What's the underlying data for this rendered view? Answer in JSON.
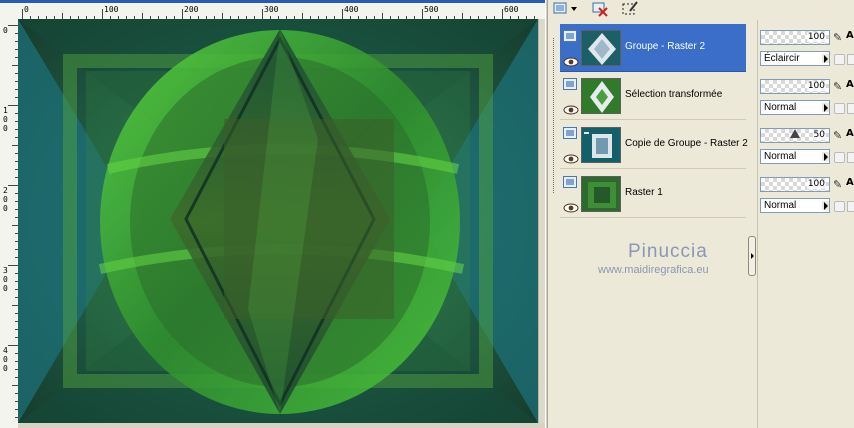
{
  "ruler": {
    "top_labels": [
      "0",
      "100",
      "200",
      "300",
      "400",
      "500",
      "600"
    ],
    "left_labels": [
      [
        "0"
      ],
      [
        "1",
        "0",
        "0"
      ],
      [
        "2",
        "0",
        "0"
      ],
      [
        "3",
        "0",
        "0"
      ],
      [
        "4",
        "0",
        "0"
      ]
    ]
  },
  "canvas": {
    "colors": {
      "dark": "#1d4a3a",
      "mid": "#2e7a3b",
      "bright": "#54c23a",
      "teal": "#1e6f78"
    }
  },
  "toolbar": {
    "icons": [
      "new-layer-icon",
      "dropdown-arrow-icon",
      "delete-layer-icon",
      "edit-selection-icon"
    ]
  },
  "layers": [
    {
      "name": "Groupe - Raster 2",
      "selected": true,
      "opacity": "100",
      "blend": "Éclaircir"
    },
    {
      "name": "Sélection transformée",
      "selected": false,
      "opacity": "100",
      "blend": "Normal"
    },
    {
      "name": "Copie de Groupe - Raster 2",
      "selected": false,
      "opacity": "50",
      "blend": "Normal"
    },
    {
      "name": "Raster 1",
      "selected": false,
      "opacity": "100",
      "blend": "Normal"
    }
  ],
  "watermark": {
    "name": "Pinuccia",
    "url": "www.maidiregrafica.eu"
  },
  "accent": "#3a6ec8"
}
